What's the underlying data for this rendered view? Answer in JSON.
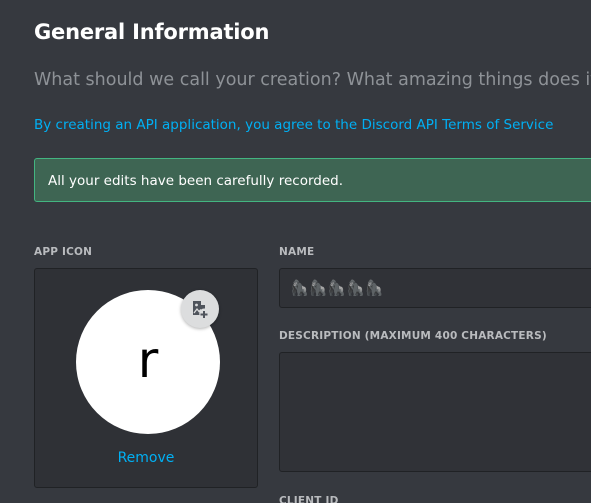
{
  "header": {
    "title": "General Information",
    "subtitle": "What should we call your creation? What amazing things does it do?",
    "tos_text": "By creating an API application, you agree to the Discord API Terms of Service"
  },
  "notice": {
    "message": "All your edits have been carefully recorded.",
    "color": "#43b581"
  },
  "app_icon": {
    "label": "APP ICON",
    "avatar_letter": "r",
    "upload_icon": "image-add-icon",
    "remove_label": "Remove"
  },
  "form": {
    "name_label": "NAME",
    "name_value": "🦍🦍🦍🦍🦍",
    "description_label": "DESCRIPTION (MAXIMUM 400 CHARACTERS)",
    "description_value": "",
    "client_id_label": "CLIENT ID"
  },
  "colors": {
    "background": "#36393f",
    "link": "#00b0f4",
    "input_background": "#303237"
  }
}
